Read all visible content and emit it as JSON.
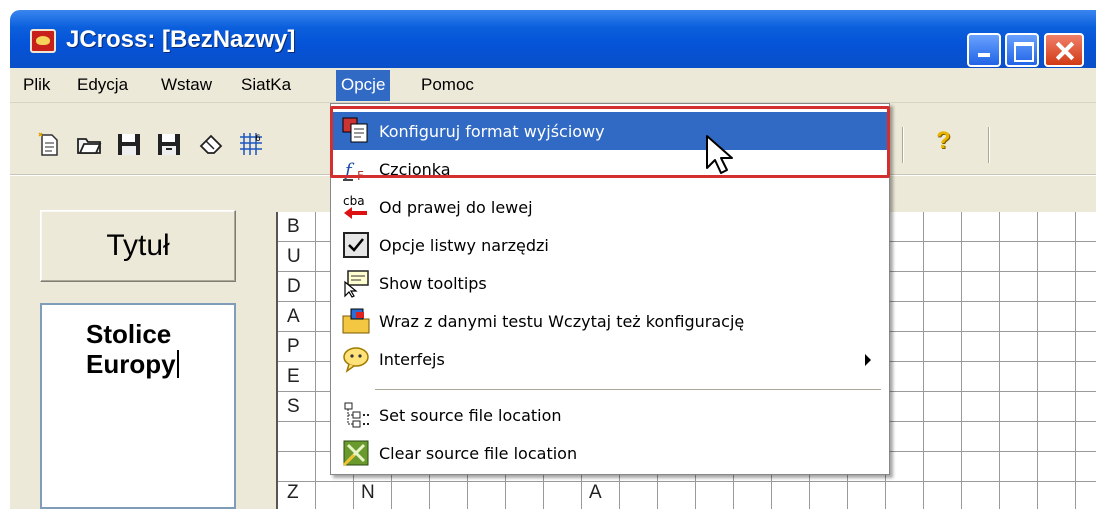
{
  "window": {
    "title": "JCross: [BezNazwy]"
  },
  "menubar": {
    "items": [
      "Plik",
      "Edycja",
      "Wstaw",
      "SiatKa",
      "Opcje",
      "Pomoc"
    ],
    "active": "Opcje"
  },
  "toolbar": {
    "icons": [
      "new-file-icon",
      "open-folder-icon",
      "save-icon",
      "save-as-icon",
      "eraser-icon",
      "grid-generate-icon",
      "help-icon"
    ],
    "help_label": "?"
  },
  "crossword": {
    "title_label": "Tytuł",
    "description": "Stolice\nEuropy",
    "column_letters": [
      "B",
      "U",
      "D",
      "A",
      "P",
      "E",
      "S",
      "Z"
    ],
    "bottom_row_letters": [
      "N",
      "A"
    ]
  },
  "opcje_menu": {
    "items": [
      {
        "label": "Konfiguruj format wyjściowy",
        "icon": "format-config-icon",
        "highlighted": true
      },
      {
        "label": "Czcionka",
        "icon": "font-icon"
      },
      {
        "label": "Od prawej do lewej",
        "icon": "rtl-icon",
        "icon_text": "cba"
      },
      {
        "label": "Opcje listwy narzędzi",
        "icon": "toolbar-options-icon"
      },
      {
        "label": "Show tooltips",
        "icon": "tooltip-icon"
      },
      {
        "label": "Wraz z danymi testu Wczytaj też konfigurację",
        "icon": "load-config-icon"
      },
      {
        "label": "Interfejs",
        "icon": "interface-icon",
        "submenu": true
      },
      {
        "label": "Set source file location",
        "icon": "source-location-icon"
      },
      {
        "label": "Clear source file location",
        "icon": "clear-location-icon"
      }
    ]
  },
  "colors": {
    "highlight": "#316ac5",
    "frame": "#d32f2f",
    "titlebar": "#0553d8"
  }
}
